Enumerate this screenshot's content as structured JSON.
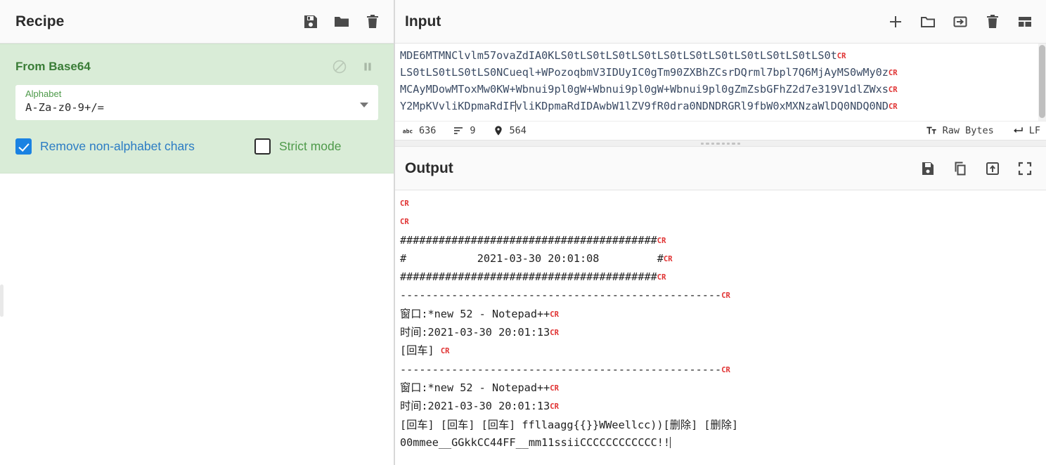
{
  "recipe": {
    "title": "Recipe",
    "icons": [
      "save-icon",
      "folder-icon",
      "trash-icon"
    ],
    "operation": {
      "name": "From Base64",
      "disable_icon": "disable-icon",
      "pause_icon": "breakpoint-pause-icon",
      "argument": {
        "label": "Alphabet",
        "value": "A-Za-z0-9+/=",
        "dropdown_icon": "chevron-down-icon"
      },
      "checkboxes": [
        {
          "label": "Remove non-alphabet chars",
          "checked": true
        },
        {
          "label": "Strict mode",
          "checked": false
        }
      ]
    }
  },
  "input": {
    "title": "Input",
    "icons": [
      "add-tab-icon",
      "open-folder-icon",
      "open-input-icon",
      "clear-icon",
      "reset-layout-icon"
    ],
    "text_lines": [
      "MDE6MTMNClvlm57ovaZdIA0KLS0tLS0tLS0tLS0tLS0tLS0tLS0tLS0tLS0tLS0tLS0t",
      "LS0tLS0tLS0tLS0NCueql+WPozoqbmV3IDUyIC0gTm90ZXBhZCsrDQrml7bpl7Q6MjAyMS0wMy0z",
      "MCAyMDowMToxMw0KW+Wbnui9pl0gW+Wbnui9pl0gW+Wbnui9pl0gZmZsbGFhZ2d7e319V1dlZWxs",
      "Y2MpKVvliKDpmaRdIFvliKDpmaRdIDAwbW1lZV9fR0dra0NDNDRGRl9fbW0xMXNzaWlDQ0NDQ0ND"
    ],
    "status": {
      "length_icon": "abc-length-icon",
      "length": "636",
      "lines_icon": "lines-icon",
      "lines": "9",
      "position_icon": "position-pin-icon",
      "position": "564",
      "encoding_icon": "character-encoding-icon",
      "encoding": "Raw Bytes",
      "line_ending_icon": "line-ending-icon",
      "line_ending": "LF"
    }
  },
  "output": {
    "title": "Output",
    "icons": [
      "save-output-icon",
      "copy-icon",
      "replace-input-icon",
      "maximise-icon"
    ],
    "lines": [
      {
        "text": "",
        "cr": true
      },
      {
        "text": "",
        "cr": true
      },
      {
        "text": "########################################",
        "cr": true
      },
      {
        "text": "#           2021-03-30 20:01:08         #",
        "cr": true
      },
      {
        "text": "########################################",
        "cr": true
      },
      {
        "text": "--------------------------------------------------",
        "cr": true
      },
      {
        "text": "窗口:*new 52 - Notepad++",
        "cr": true
      },
      {
        "text": "时间:2021-03-30 20:01:13",
        "cr": true
      },
      {
        "text": "[回车] ",
        "cr": true
      },
      {
        "text": "--------------------------------------------------",
        "cr": true
      },
      {
        "text": "窗口:*new 52 - Notepad++",
        "cr": true
      },
      {
        "text": "时间:2021-03-30 20:01:13",
        "cr": true
      },
      {
        "text": "[回车] [回车] [回车] ffllaagg{{}}WWeellcc))[删除] [删除]",
        "cr": false
      },
      {
        "text": "00mmee__GGkkCC44FF__mm11ssiiCCCCCCCCCCCC!!",
        "cr": false,
        "caret": true
      }
    ]
  },
  "colors": {
    "operation_bg": "#d9ecd7",
    "operation_title": "#3a7d37",
    "checkbox_accent": "#1a82e2",
    "cr_marker": "#e03131",
    "input_text": "#3a4a63"
  }
}
